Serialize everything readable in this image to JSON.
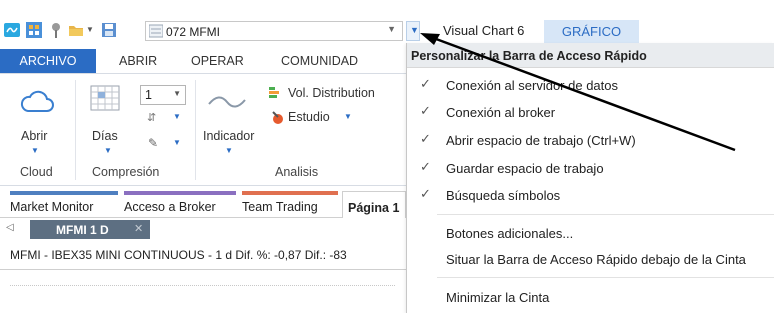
{
  "qat": {
    "symbol": "072 MFMI",
    "app_title": "Visual Chart 6",
    "context_tab": "GRÁFICO"
  },
  "ribbon_tabs": [
    "ARCHIVO",
    "ABRIR",
    "OPERAR",
    "COMUNIDAD"
  ],
  "ribbon": {
    "cloud": {
      "abrir": "Abrir",
      "group": "Cloud"
    },
    "compresion": {
      "dias": "Días",
      "value": "1",
      "group": "Compresión"
    },
    "analisis": {
      "indicador": "Indicador",
      "vol_distribution": "Vol. Distribution",
      "estudio": "Estudio",
      "group": "Analisis"
    }
  },
  "doc_tabs": [
    {
      "label": "Market Monitor",
      "color": "#4f7fc0"
    },
    {
      "label": "Acceso a Broker",
      "color": "#8a6fc0"
    },
    {
      "label": "Team Trading",
      "color": "#e07050"
    },
    {
      "label": "Página 1",
      "color": "#ffffff"
    }
  ],
  "chart": {
    "tab": "MFMI 1 D",
    "header": "MFMI - IBEX35 MINI CONTINUOUS - 1 d  Dif. %: -0,87  Dif.: -83"
  },
  "menu": {
    "title": "Personalizar la Barra de Acceso Rápido",
    "items": [
      {
        "label": "Conexión al servidor de datos",
        "checked": "✓"
      },
      {
        "label": "Conexión al broker",
        "checked": "✓"
      },
      {
        "label": "Abrir espacio de trabajo (Ctrl+W)",
        "checked": "✓"
      },
      {
        "label": "Guardar espacio de trabajo",
        "checked": "✓"
      },
      {
        "label": "Búsqueda símbolos",
        "checked": "✓"
      },
      {
        "label": "Botones adicionales...",
        "checked": ""
      },
      {
        "label": "Situar la Barra de Acceso Rápido debajo de la Cinta",
        "checked": ""
      },
      {
        "label": "Minimizar la Cinta",
        "checked": ""
      }
    ]
  },
  "colors": {
    "accent": "#2b6cc4",
    "menu_header_bg": "#e9ecef",
    "chart_tab_bg": "#5d6f82"
  }
}
